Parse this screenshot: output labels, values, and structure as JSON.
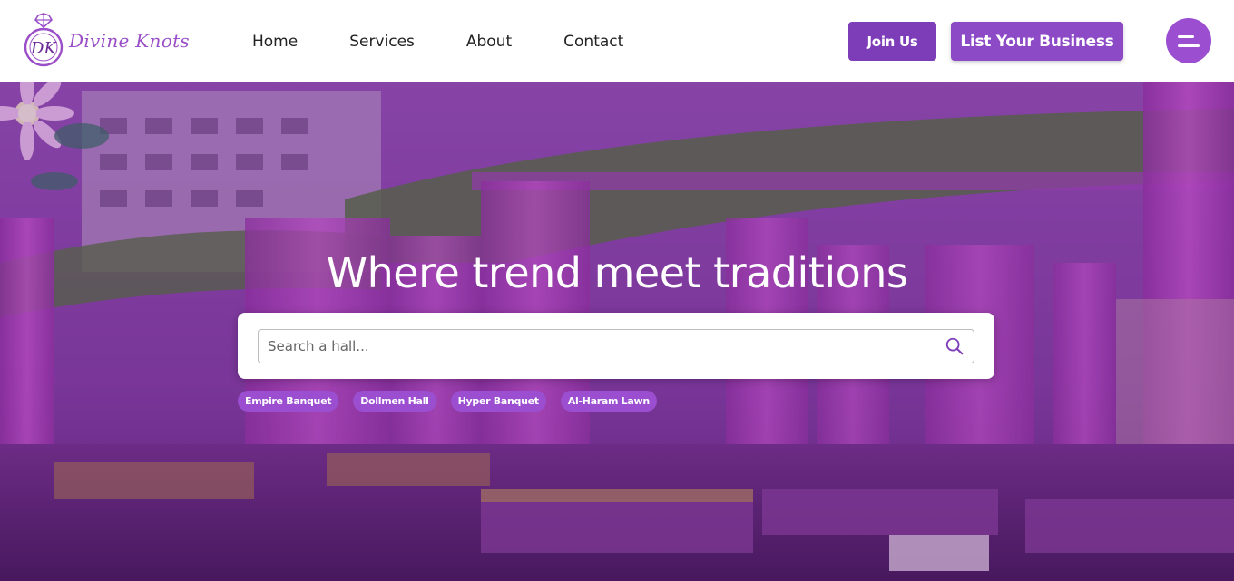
{
  "brand": {
    "name": "Divine Knots",
    "monogram": "DK"
  },
  "nav": {
    "links": [
      "Home",
      "Services",
      "About",
      "Contact"
    ]
  },
  "actions": {
    "join_label": "Join Us",
    "list_business_label": "List Your Business",
    "menu_icon": "menu-icon"
  },
  "hero": {
    "headline": "Where trend meet traditions",
    "search": {
      "placeholder": "Search a hall...",
      "value": "",
      "icon": "search-icon"
    },
    "tags": [
      "Empire Banquet",
      "Dollmen Hall",
      "Hyper Banquet",
      "Al-Haram Lawn"
    ]
  },
  "colors": {
    "primary": "#7d3cb8",
    "accent": "#9b4fd0",
    "text_dark": "#222222",
    "white": "#ffffff"
  }
}
